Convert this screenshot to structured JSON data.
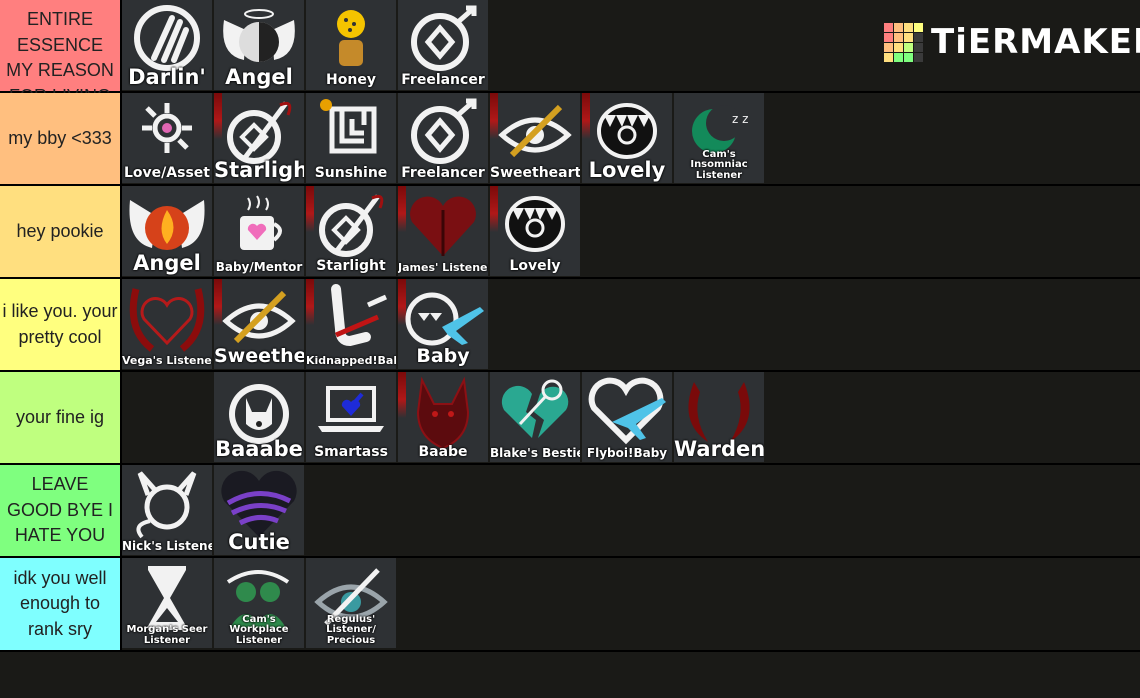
{
  "logo": {
    "text": "TiERMAKER",
    "grid_colors": [
      "#ff7f7f",
      "#ffbf7f",
      "#ffdf7f",
      "#ffff7f",
      "#ff7f7f",
      "#ffbf7f",
      "#ffdf7f",
      "#3a3a3a",
      "#ffbf7f",
      "#ffdf7f",
      "#bfff7f",
      "#3a3a3a",
      "#ffdf7f",
      "#7fff7f",
      "#7fff7f",
      "#3a3a3a"
    ]
  },
  "tiers": [
    {
      "label": "YOU ARE MY ENTIRE ESSENCE MY REASON FOR LIVING",
      "color": "#ff7f7f",
      "items": [
        {
          "caption": "Darlin'",
          "icon": "claw-mark-icon",
          "size": "xl"
        },
        {
          "caption": "Angel",
          "icon": "winged-moon-icon",
          "size": "xl"
        },
        {
          "caption": "Honey",
          "icon": "honey-pot-icon",
          "size": "md"
        },
        {
          "caption": "Freelancer",
          "icon": "freelancer-symbol-icon",
          "size": "md"
        }
      ]
    },
    {
      "label": "my bby <333",
      "color": "#ffbf7f",
      "items": [
        {
          "caption": "Love/Asset",
          "icon": "flower-link-icon",
          "size": "md"
        },
        {
          "caption": "Starlight",
          "icon": "starlight-symbol-icon",
          "size": "xl"
        },
        {
          "caption": "Sunshine",
          "icon": "maze-sun-icon",
          "size": "md"
        },
        {
          "caption": "Freelancer",
          "icon": "freelancer-symbol-icon",
          "size": "md"
        },
        {
          "caption": "Sweetheart",
          "icon": "crossed-eye-icon",
          "size": "md"
        },
        {
          "caption": "Lovely",
          "icon": "fanged-mouth-icon",
          "size": "xl"
        },
        {
          "caption": "Cam's Insomniac Listener",
          "icon": "sleepy-moon-icon",
          "size": "xxs"
        }
      ]
    },
    {
      "label": "hey pookie",
      "color": "#ffdf7f",
      "items": [
        {
          "caption": "Angel",
          "icon": "winged-flame-icon",
          "size": "xl"
        },
        {
          "caption": "Baby/Mentor",
          "icon": "heart-mug-icon",
          "size": "sm"
        },
        {
          "caption": "Starlight",
          "icon": "starlight-symbol-icon",
          "size": "md"
        },
        {
          "caption": "James' Listener",
          "icon": "red-heart-icon",
          "size": "xs"
        },
        {
          "caption": "Lovely",
          "icon": "fanged-mouth-icon",
          "size": "md"
        }
      ]
    },
    {
      "label": "i like you. your pretty cool",
      "color": "#ffff7f",
      "items": [
        {
          "caption": "Vega's Listener",
          "icon": "horned-heart-icon",
          "size": "xs"
        },
        {
          "caption": "Sweetheart",
          "icon": "crossed-eye-icon",
          "size": "lg"
        },
        {
          "caption": "Kidnapped!Baby",
          "icon": "bound-hand-icon",
          "size": "xs"
        },
        {
          "caption": "Baby",
          "icon": "plane-fangs-icon",
          "size": "lg"
        }
      ]
    },
    {
      "label": "your fine ig",
      "color": "#bfff7f",
      "items": [
        {
          "caption": "",
          "icon": "",
          "size": "md",
          "empty": true
        },
        {
          "caption": "Baaabe",
          "icon": "dog-circle-icon",
          "size": "xl"
        },
        {
          "caption": "Smartass",
          "icon": "laptop-heart-icon",
          "size": "md"
        },
        {
          "caption": "Baabe",
          "icon": "red-dog-icon",
          "size": "md"
        },
        {
          "caption": "Blake's Bestie",
          "icon": "broken-heart-icon",
          "size": "sm"
        },
        {
          "caption": "Flyboi!Baby",
          "icon": "heart-plane-icon",
          "size": "sm"
        },
        {
          "caption": "Warden",
          "icon": "red-horns-icon",
          "size": "xl"
        }
      ]
    },
    {
      "label": "LEAVE GOOD BYE I HATE YOU",
      "color": "#7fff7f",
      "items": [
        {
          "caption": "Nick's Listener",
          "icon": "horned-circle-icon",
          "size": "sm"
        },
        {
          "caption": "Cutie",
          "icon": "purple-heart-icon",
          "size": "xl"
        }
      ]
    },
    {
      "label": "idk you well enough to rank sry",
      "color": "#7fffff",
      "items": [
        {
          "caption": "Morgan's Seer Listener",
          "icon": "hourglass-icon",
          "size": "xxs"
        },
        {
          "caption": "Cam's Workplace Listener",
          "icon": "green-figures-icon",
          "size": "xxs"
        },
        {
          "caption": "Regulus' Listener/ Precious",
          "icon": "slashed-eye-icon",
          "size": "xxs"
        }
      ]
    }
  ]
}
